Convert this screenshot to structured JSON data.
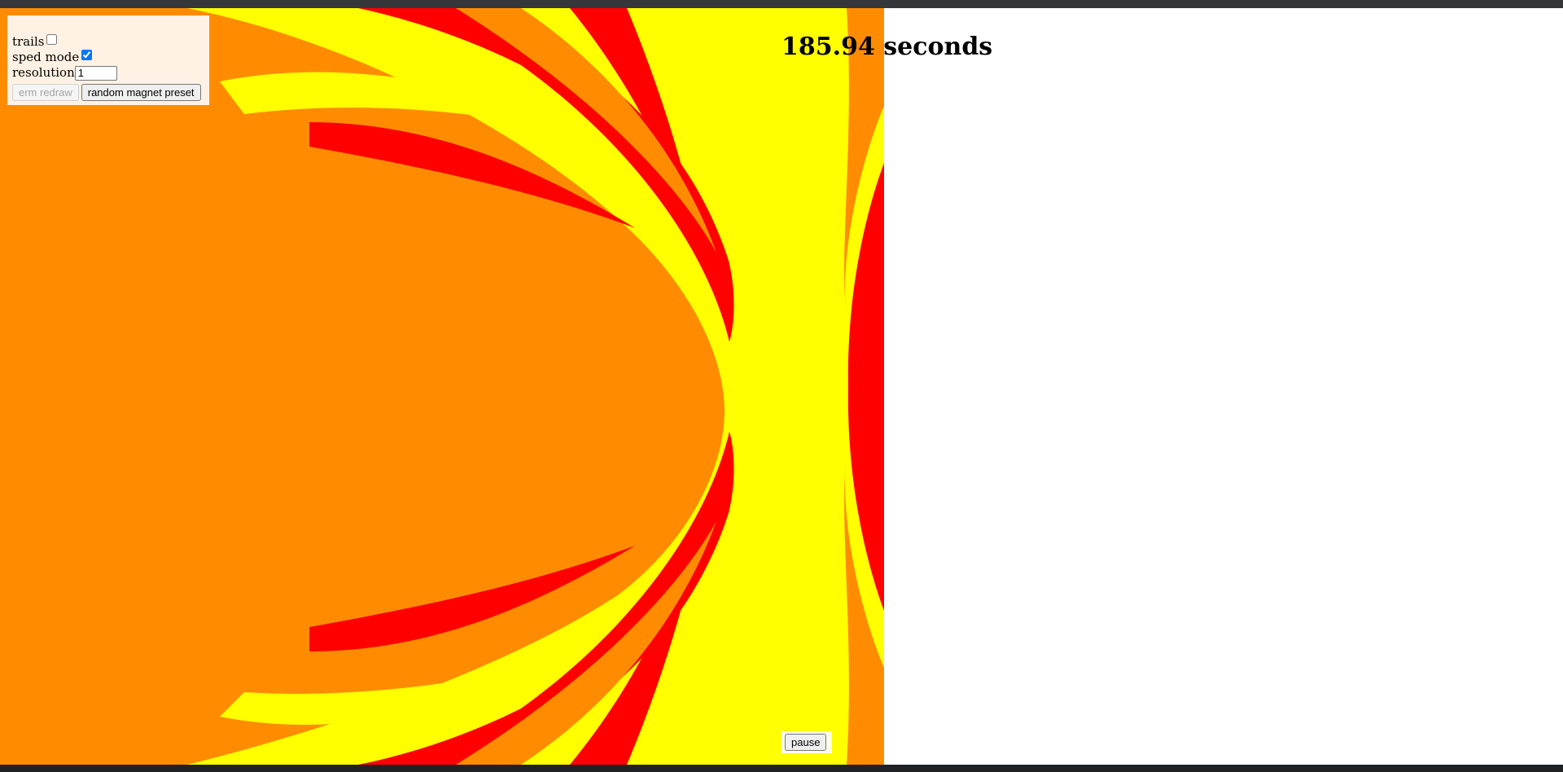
{
  "controls": {
    "trails_label": "trails",
    "trails_checked": false,
    "sped_mode_label": "sped mode",
    "sped_mode_checked": true,
    "resolution_label": "resolution",
    "resolution_value": "1",
    "redraw_button": "erm redraw",
    "redraw_disabled": true,
    "preset_button": "random magnet preset"
  },
  "timer": {
    "text": "185.94 seconds"
  },
  "pause_button": "pause",
  "colors": {
    "basin_orange": "#ff8c00",
    "basin_yellow": "#ffff00",
    "basin_red": "#ff0000"
  }
}
